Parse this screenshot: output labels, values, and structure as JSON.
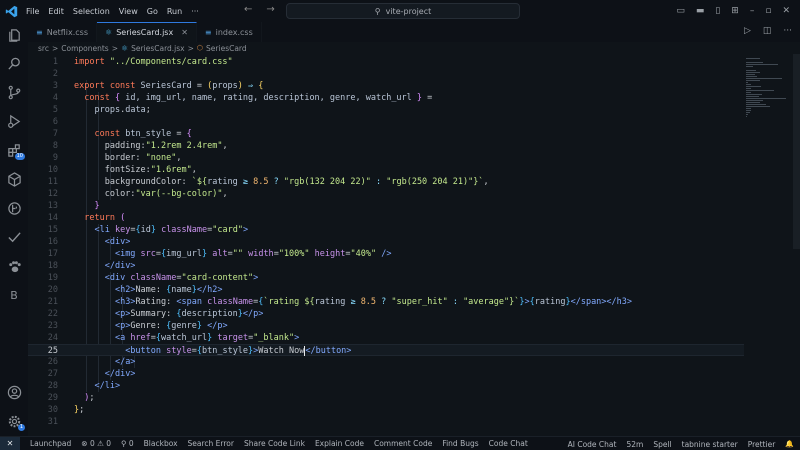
{
  "titlebar": {
    "menus": [
      "File",
      "Edit",
      "Selection",
      "View",
      "Go",
      "Run",
      "···"
    ],
    "search": "vite-project"
  },
  "activity": {
    "badge": "10",
    "account_badge": "1",
    "b_label": "B"
  },
  "tabs": [
    {
      "label": "Netflix.css",
      "icon": "css-icon",
      "active": false
    },
    {
      "label": "SeriesCard.jsx",
      "icon": "react-icon",
      "active": true
    },
    {
      "label": "index.css",
      "icon": "css-icon",
      "active": false
    }
  ],
  "breadcrumb": {
    "src": "src",
    "components": "Components",
    "file": "SeriesCard.jsx",
    "symbol": "SeriesCard",
    "sep": ">"
  },
  "editor": {
    "current_line": 25,
    "lines": [
      [
        [
          "kw",
          "import "
        ],
        [
          "str",
          "\"../Components/card.css\""
        ]
      ],
      [],
      [
        [
          "kw",
          "export const "
        ],
        [
          "var",
          "SeriesCard"
        ],
        [
          "plain",
          " = "
        ],
        [
          "br1",
          "("
        ],
        [
          "var",
          "props"
        ],
        [
          "br1",
          ")"
        ],
        [
          "op",
          " ⇒ "
        ],
        [
          "br1",
          "{"
        ]
      ],
      [
        [
          "plain",
          "  "
        ],
        [
          "kw",
          "const "
        ],
        [
          "br2",
          "{"
        ],
        [
          "var",
          " id, img_url, name, rating, description, genre, watch_url "
        ],
        [
          "br2",
          "}"
        ],
        [
          "plain",
          " ="
        ]
      ],
      [
        [
          "plain",
          "    "
        ],
        [
          "var",
          "props"
        ],
        [
          "plain",
          "."
        ],
        [
          "var",
          "data"
        ],
        [
          "plain",
          ";"
        ]
      ],
      [],
      [
        [
          "plain",
          "    "
        ],
        [
          "kw",
          "const "
        ],
        [
          "var",
          "btn_style"
        ],
        [
          "plain",
          " = "
        ],
        [
          "br2",
          "{"
        ]
      ],
      [
        [
          "plain",
          "      "
        ],
        [
          "plain",
          "padding:"
        ],
        [
          "str",
          "\"1.2rem 2.4rem\""
        ],
        [
          "plain",
          ","
        ]
      ],
      [
        [
          "plain",
          "      "
        ],
        [
          "plain",
          "border: "
        ],
        [
          "str",
          "\"none\""
        ],
        [
          "plain",
          ","
        ]
      ],
      [
        [
          "plain",
          "      "
        ],
        [
          "plain",
          "fontSize:"
        ],
        [
          "str",
          "\"1.6rem\""
        ],
        [
          "plain",
          ","
        ]
      ],
      [
        [
          "plain",
          "      "
        ],
        [
          "plain",
          "backgroundColor: "
        ],
        [
          "str",
          "`${"
        ],
        [
          "var",
          "rating"
        ],
        [
          "op",
          " ≥ "
        ],
        [
          "num",
          "8.5"
        ],
        [
          "op",
          " ? "
        ],
        [
          "str",
          "\"rgb(132 204 22)\""
        ],
        [
          "op",
          " : "
        ],
        [
          "str",
          "\"rgb(250 204 21)\""
        ],
        [
          "str",
          "}`"
        ],
        [
          "plain",
          ","
        ]
      ],
      [
        [
          "plain",
          "      "
        ],
        [
          "plain",
          "color:"
        ],
        [
          "str",
          "\"var(--bg-color)\""
        ],
        [
          "plain",
          ","
        ]
      ],
      [
        [
          "plain",
          "    "
        ],
        [
          "br2",
          "}"
        ]
      ],
      [
        [
          "plain",
          "  "
        ],
        [
          "kw",
          "return "
        ],
        [
          "br2",
          "("
        ]
      ],
      [
        [
          "plain",
          "    "
        ],
        [
          "tag",
          "<li "
        ],
        [
          "attr",
          "key"
        ],
        [
          "plain",
          "="
        ],
        [
          "br3",
          "{"
        ],
        [
          "var",
          "id"
        ],
        [
          "br3",
          "}"
        ],
        [
          "attr",
          " className"
        ],
        [
          "plain",
          "="
        ],
        [
          "str",
          "\"card\""
        ],
        [
          "tag",
          ">"
        ]
      ],
      [
        [
          "plain",
          "      "
        ],
        [
          "tag",
          "<div>"
        ]
      ],
      [
        [
          "plain",
          "        "
        ],
        [
          "tag",
          "<img "
        ],
        [
          "attr",
          "src"
        ],
        [
          "plain",
          "="
        ],
        [
          "br3",
          "{"
        ],
        [
          "var",
          "img_url"
        ],
        [
          "br3",
          "}"
        ],
        [
          "attr",
          " alt"
        ],
        [
          "plain",
          "="
        ],
        [
          "str",
          "\"\""
        ],
        [
          "attr",
          " width"
        ],
        [
          "plain",
          "="
        ],
        [
          "str",
          "\"100%\""
        ],
        [
          "attr",
          " height"
        ],
        [
          "plain",
          "="
        ],
        [
          "str",
          "\"40%\""
        ],
        [
          "tag",
          " />"
        ]
      ],
      [
        [
          "plain",
          "      "
        ],
        [
          "tag",
          "</div>"
        ]
      ],
      [
        [
          "plain",
          "      "
        ],
        [
          "tag",
          "<div "
        ],
        [
          "attr",
          "className"
        ],
        [
          "plain",
          "="
        ],
        [
          "str",
          "\"card-content\""
        ],
        [
          "tag",
          ">"
        ]
      ],
      [
        [
          "plain",
          "        "
        ],
        [
          "tag",
          "<h2>"
        ],
        [
          "plain",
          "Name: "
        ],
        [
          "br3",
          "{"
        ],
        [
          "var",
          "name"
        ],
        [
          "br3",
          "}"
        ],
        [
          "tag",
          "</h2>"
        ]
      ],
      [
        [
          "plain",
          "        "
        ],
        [
          "tag",
          "<h3>"
        ],
        [
          "plain",
          "Rating: "
        ],
        [
          "tag",
          "<span "
        ],
        [
          "attr",
          "className"
        ],
        [
          "plain",
          "="
        ],
        [
          "br3",
          "{"
        ],
        [
          "str",
          "`rating ${"
        ],
        [
          "var",
          "rating"
        ],
        [
          "op",
          " ≥ "
        ],
        [
          "num",
          "8.5"
        ],
        [
          "op",
          " ? "
        ],
        [
          "str",
          "\"super_hit\""
        ],
        [
          "op",
          " : "
        ],
        [
          "str",
          "\"average\""
        ],
        [
          "str",
          "}`"
        ],
        [
          "br3",
          "}"
        ],
        [
          "tag",
          ">"
        ],
        [
          "br3",
          "{"
        ],
        [
          "var",
          "rating"
        ],
        [
          "br3",
          "}"
        ],
        [
          "tag",
          "</span></h3>"
        ]
      ],
      [
        [
          "plain",
          "        "
        ],
        [
          "tag",
          "<p>"
        ],
        [
          "plain",
          "Summary: "
        ],
        [
          "br3",
          "{"
        ],
        [
          "var",
          "description"
        ],
        [
          "br3",
          "}"
        ],
        [
          "tag",
          "</p>"
        ]
      ],
      [
        [
          "plain",
          "        "
        ],
        [
          "tag",
          "<p>"
        ],
        [
          "plain",
          "Genre: "
        ],
        [
          "br3",
          "{"
        ],
        [
          "var",
          "genre"
        ],
        [
          "br3",
          "}"
        ],
        [
          "tag",
          " </p>"
        ]
      ],
      [
        [
          "plain",
          "        "
        ],
        [
          "tag",
          "<a "
        ],
        [
          "attr",
          "href"
        ],
        [
          "plain",
          "="
        ],
        [
          "br3",
          "{"
        ],
        [
          "var",
          "watch_url"
        ],
        [
          "br3",
          "}"
        ],
        [
          "attr",
          " target"
        ],
        [
          "plain",
          "="
        ],
        [
          "str",
          "\"_blank\""
        ],
        [
          "tag",
          ">"
        ]
      ],
      [
        [
          "plain",
          "          "
        ],
        [
          "tag",
          "<button "
        ],
        [
          "attr",
          "style"
        ],
        [
          "plain",
          "="
        ],
        [
          "br3",
          "{"
        ],
        [
          "var",
          "btn_style"
        ],
        [
          "br3",
          "}"
        ],
        [
          "tag",
          ">"
        ],
        [
          "plain",
          "Watch Now"
        ],
        [
          "cursor",
          ""
        ],
        [
          "tag",
          "</button>"
        ]
      ],
      [
        [
          "plain",
          "        "
        ],
        [
          "tag",
          "</a>"
        ]
      ],
      [
        [
          "plain",
          "      "
        ],
        [
          "tag",
          "</div>"
        ]
      ],
      [
        [
          "plain",
          "    "
        ],
        [
          "tag",
          "</li>"
        ]
      ],
      [
        [
          "plain",
          "  "
        ],
        [
          "br2",
          ")"
        ],
        [
          "plain",
          ";"
        ]
      ],
      [
        [
          "br1",
          "}"
        ],
        [
          "plain",
          ";"
        ]
      ],
      []
    ]
  },
  "status": {
    "left": [
      "Launchpad",
      "⊗ 0 ⚠ 0",
      "⚲ 0",
      "Blackbox",
      "Search Error",
      "Share Code Link",
      "Explain Code",
      "Comment Code",
      "Find Bugs",
      "Code Chat"
    ],
    "right": [
      "AI Code Chat",
      "52m",
      "Spell",
      "tabnine starter",
      "Prettier"
    ]
  }
}
